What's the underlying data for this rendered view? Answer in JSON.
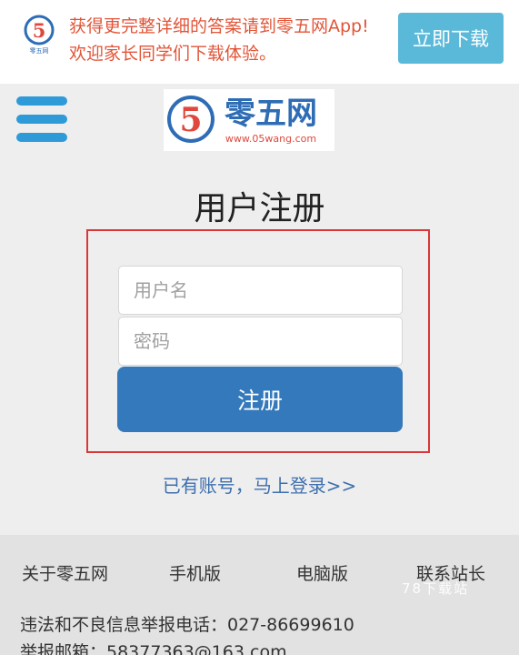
{
  "banner": {
    "logo_label": "零五网",
    "message_line1": "获得更完整详细的答案请到零五网App!",
    "message_line2": "欢迎家长同学们下载体验。",
    "download_label": "立即下载"
  },
  "header": {
    "menu_icon": "hamburger-menu-icon",
    "logo_text": "零五网",
    "logo_url": "www.05wang.com"
  },
  "form": {
    "title": "用户注册",
    "username_placeholder": "用户名",
    "password_placeholder": "密码",
    "submit_label": "注册",
    "login_link": "已有账号，马上登录>>"
  },
  "footer": {
    "nav": [
      "关于零五网",
      "手机版",
      "电脑版",
      "联系站长"
    ],
    "phone_line": "违法和不良信息举报电话：027-86699610",
    "email_line": "举报邮箱：58377363@163.com"
  },
  "watermark": "78下载站",
  "colors": {
    "accent_blue": "#3479bc",
    "menu_blue": "#2e9bd8",
    "download_button": "#5ab9d9",
    "banner_text": "#e25538",
    "form_border": "#d9373a",
    "link": "#3d6fae"
  }
}
